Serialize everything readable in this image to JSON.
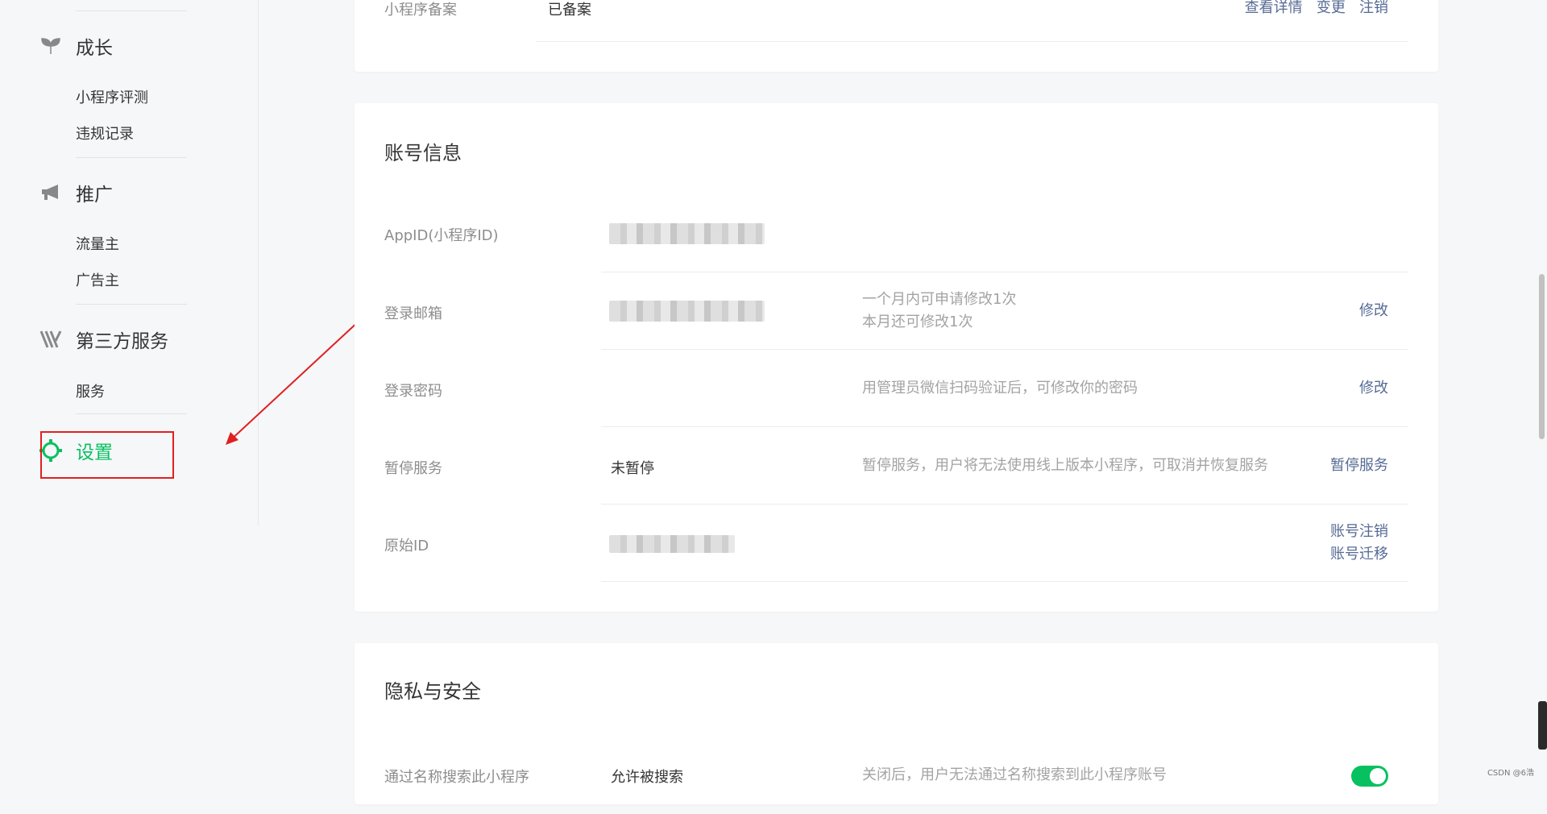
{
  "sidebar": {
    "groups": [
      {
        "title": "成长",
        "icon": "sprout-icon",
        "items": [
          "小程序评测",
          "违规记录"
        ]
      },
      {
        "title": "推广",
        "icon": "megaphone-icon",
        "items": [
          "流量主",
          "广告主"
        ]
      },
      {
        "title": "第三方服务",
        "icon": "third-party-icon",
        "items": [
          "服务"
        ]
      }
    ],
    "settings": {
      "label": "设置",
      "icon": "gear-icon",
      "color": "#07c160"
    }
  },
  "registration_row": {
    "label": "小程序备案",
    "value": "已备案",
    "actions": [
      "查看详情",
      "变更",
      "注销"
    ]
  },
  "account_info": {
    "title": "账号信息",
    "rows": [
      {
        "label": "AppID(小程序ID)",
        "value": "",
        "desc": "",
        "actions": []
      },
      {
        "label": "登录邮箱",
        "value": "",
        "desc_lines": [
          "一个月内可申请修改1次",
          "本月还可修改1次"
        ],
        "actions": [
          "修改"
        ]
      },
      {
        "label": "登录密码",
        "value": "",
        "desc": "用管理员微信扫码验证后，可修改你的密码",
        "actions": [
          "修改"
        ]
      },
      {
        "label": "暂停服务",
        "value": "未暂停",
        "desc": "暂停服务，用户将无法使用线上版本小程序，可取消并恢复服务",
        "actions": [
          "暂停服务"
        ]
      },
      {
        "label": "原始ID",
        "value": "",
        "desc": "",
        "actions": [
          "账号注销",
          "账号迁移"
        ]
      }
    ]
  },
  "privacy": {
    "title": "隐私与安全",
    "rows": [
      {
        "label": "通过名称搜索此小程序",
        "value": "允许被搜索",
        "desc": "关闭后，用户无法通过名称搜索到此小程序账号",
        "toggle_on": true
      }
    ]
  },
  "watermark": "CSDN @6浩",
  "colors": {
    "link": "#576b95",
    "brand_green": "#07c160",
    "annotation_red": "#e02020"
  }
}
